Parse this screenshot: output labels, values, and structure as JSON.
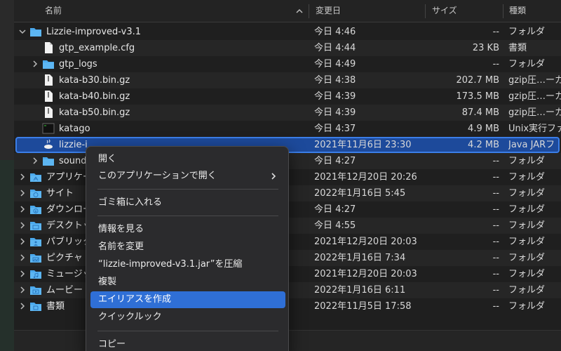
{
  "header": {
    "name": "名前",
    "date": "変更日",
    "size": "サイズ",
    "kind": "種類"
  },
  "rows": [
    {
      "name": "Lizzie-improved-v3.1",
      "date": "今日 4:46",
      "size": "--",
      "kind": "フォルダ",
      "icon": "folder-icon",
      "expanded": true
    },
    {
      "name": "gtp_example.cfg",
      "date": "今日 4:44",
      "size": "23 KB",
      "kind": "書類",
      "icon": "document-icon"
    },
    {
      "name": "gtp_logs",
      "date": "今日 4:49",
      "size": "--",
      "kind": "フォルダ",
      "icon": "folder-icon"
    },
    {
      "name": "kata-b30.bin.gz",
      "date": "今日 4:38",
      "size": "202.7 MB",
      "kind": "gzip圧…ーカ",
      "icon": "archive-icon"
    },
    {
      "name": "kata-b40.bin.gz",
      "date": "今日 4:39",
      "size": "173.5 MB",
      "kind": "gzip圧…ーカ",
      "icon": "archive-icon"
    },
    {
      "name": "kata-b50.bin.gz",
      "date": "今日 4:39",
      "size": "87.4 MB",
      "kind": "gzip圧…ーカ",
      "icon": "archive-icon"
    },
    {
      "name": "katago",
      "date": "今日 4:37",
      "size": "4.9 MB",
      "kind": "Unix実行ファ",
      "icon": "terminal-icon"
    },
    {
      "name": "lizzie-i",
      "date": "2021年11月6日 23:30",
      "size": "4.2 MB",
      "kind": "Java JARフ",
      "icon": "java-icon",
      "selected": true
    },
    {
      "name": "sound",
      "date": "今日 4:27",
      "size": "--",
      "kind": "フォルダ",
      "icon": "folder-icon"
    },
    {
      "name": "アプリケー",
      "date": "2021年12月20日 20:26",
      "size": "--",
      "kind": "フォルダ",
      "icon": "applications-folder-icon"
    },
    {
      "name": "サイト",
      "date": "2022年1月16日 5:45",
      "size": "--",
      "kind": "フォルダ",
      "icon": "sites-folder-icon"
    },
    {
      "name": "ダウンロー",
      "date": "今日 4:27",
      "size": "--",
      "kind": "フォルダ",
      "icon": "downloads-folder-icon"
    },
    {
      "name": "デスクトッ",
      "date": "今日 4:55",
      "size": "--",
      "kind": "フォルダ",
      "icon": "desktop-folder-icon"
    },
    {
      "name": "パブリック",
      "date": "2021年12月20日 20:03",
      "size": "--",
      "kind": "フォルダ",
      "icon": "public-folder-icon"
    },
    {
      "name": "ピクチャ",
      "date": "2022年1月16日 7:34",
      "size": "--",
      "kind": "フォルダ",
      "icon": "pictures-folder-icon"
    },
    {
      "name": "ミュージッ",
      "date": "2021年12月20日 20:03",
      "size": "--",
      "kind": "フォルダ",
      "icon": "music-folder-icon"
    },
    {
      "name": "ムービー",
      "date": "2022年1月16日 6:11",
      "size": "--",
      "kind": "フォルダ",
      "icon": "movies-folder-icon"
    },
    {
      "name": "書類",
      "date": "2022年11月5日 17:58",
      "size": "--",
      "kind": "フォルダ",
      "icon": "documents-folder-icon"
    }
  ],
  "context_menu": {
    "open": "開く",
    "open_with": "このアプリケーションで開く",
    "trash": "ゴミ箱に入れる",
    "get_info": "情報を見る",
    "rename": "名前を変更",
    "compress": "“lizzie-improved-v3.1.jar”を圧縮",
    "duplicate": "複製",
    "make_alias": "エイリアスを作成",
    "quick_look": "クイックルック",
    "copy": "コピー"
  },
  "colors": {
    "folder": "#4aa8ec",
    "selection": "#1d4a9b",
    "menu_highlight": "#2f6fd6"
  }
}
